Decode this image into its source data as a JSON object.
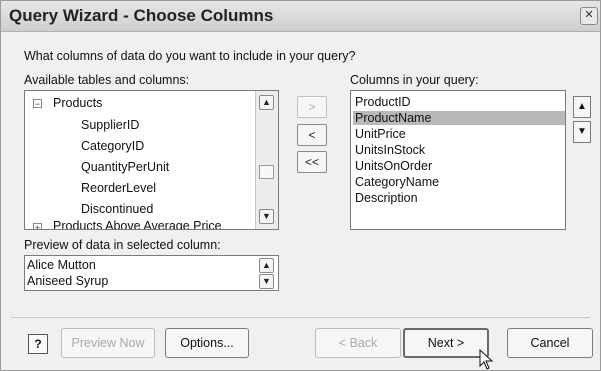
{
  "window": {
    "title": "Query Wizard - Choose Columns"
  },
  "prompt": "What columns of data do you want to include in your query?",
  "available": {
    "label": "Available tables and columns:",
    "items": [
      {
        "text": "Products",
        "expander": "−"
      },
      {
        "text": "SupplierID"
      },
      {
        "text": "CategoryID"
      },
      {
        "text": "QuantityPerUnit"
      },
      {
        "text": "ReorderLevel"
      },
      {
        "text": "Discontinued"
      },
      {
        "text": "Products Above Average Price",
        "expander": "+"
      }
    ]
  },
  "move_buttons": {
    "add": ">",
    "remove": "<",
    "remove_all": "<<"
  },
  "query_columns": {
    "label": "Columns in your query:",
    "items": [
      "ProductID",
      "ProductName",
      "UnitPrice",
      "UnitsInStock",
      "UnitsOnOrder",
      "CategoryName",
      "Description"
    ],
    "selected": "ProductName"
  },
  "preview": {
    "label": "Preview of data in selected column:",
    "items": [
      "Alice Mutton",
      "Aniseed Syrup"
    ]
  },
  "buttons": {
    "help": "?",
    "preview_now": "Preview Now",
    "options": "Options...",
    "back": "< Back",
    "next": "Next >",
    "cancel": "Cancel"
  },
  "icons": {
    "close": "close-icon",
    "scroll_up": "scroll-up-icon",
    "scroll_down": "scroll-down-icon",
    "move_up": "move-up-icon",
    "move_down": "move-down-icon",
    "cursor": "mouse-pointer-icon"
  },
  "colors": {
    "selection": "#b9b9b9",
    "background": "#f0f0f0"
  }
}
